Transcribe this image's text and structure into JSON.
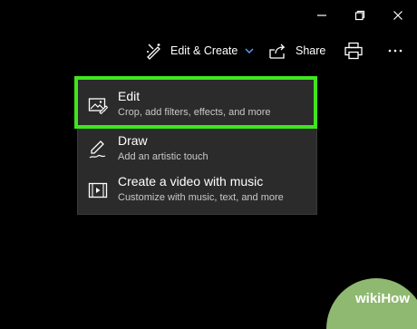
{
  "window_controls": {
    "minimize_icon": "minimize-icon",
    "restore_icon": "restore-icon",
    "close_icon": "close-icon"
  },
  "toolbar": {
    "edit_create_label": "Edit & Create",
    "share_label": "Share",
    "accent_color": "#5aa0ff"
  },
  "menu": {
    "items": [
      {
        "title": "Edit",
        "description": "Crop, add filters, effects, and more",
        "icon": "edit-image-icon"
      },
      {
        "title": "Draw",
        "description": "Add an artistic touch",
        "icon": "pen-icon"
      },
      {
        "title": "Create a video with music",
        "description": "Customize with music, text, and more",
        "icon": "video-icon"
      }
    ],
    "highlight_color": "#3ee61d"
  },
  "watermark": {
    "text": "wikiHow"
  }
}
